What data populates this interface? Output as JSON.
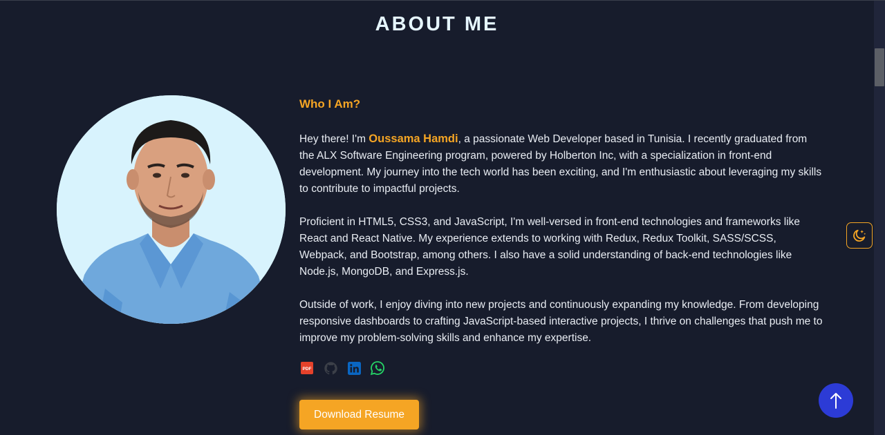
{
  "section": {
    "title": "ABOUT ME"
  },
  "about": {
    "subtitle": "Who I Am?",
    "intro_prefix": "Hey there! I'm ",
    "name": "Oussama Hamdi",
    "intro_suffix": ", a passionate Web Developer based in Tunisia. I recently graduated from the ALX Software Engineering program, powered by Holberton Inc, with a specialization in front-end development. My journey into the tech world has been exciting, and I'm enthusiastic about leveraging my skills to contribute to impactful projects.",
    "paragraph_2": "Proficient in HTML5, CSS3, and JavaScript, I'm well-versed in front-end technologies and frameworks like React and React Native. My experience extends to working with Redux, Redux Toolkit, SASS/SCSS, Webpack, and Bootstrap, among others. I also have a solid understanding of back-end technologies like Node.js, MongoDB, and Express.js.",
    "paragraph_3": "Outside of work, I enjoy diving into new projects and continuously expanding my knowledge. From developing responsive dashboards to crafting JavaScript-based interactive projects, I thrive on challenges that push me to improve my problem-solving skills and enhance my expertise."
  },
  "socials": [
    {
      "icon": "pdf-icon",
      "label": "PDF",
      "color": "#e5422b"
    },
    {
      "icon": "github-icon",
      "color": "#3b3f48"
    },
    {
      "icon": "linkedin-icon",
      "color": "#0a66c2"
    },
    {
      "icon": "whatsapp-icon",
      "color": "#25d366"
    }
  ],
  "actions": {
    "download_label": "Download Resume",
    "scroll_top_symbol": "↑"
  },
  "colors": {
    "background": "#171c2c",
    "accent": "#f5a524",
    "title": "#e6f6ff",
    "text": "#e9edf3",
    "scroll_button": "#2c3bd6"
  }
}
